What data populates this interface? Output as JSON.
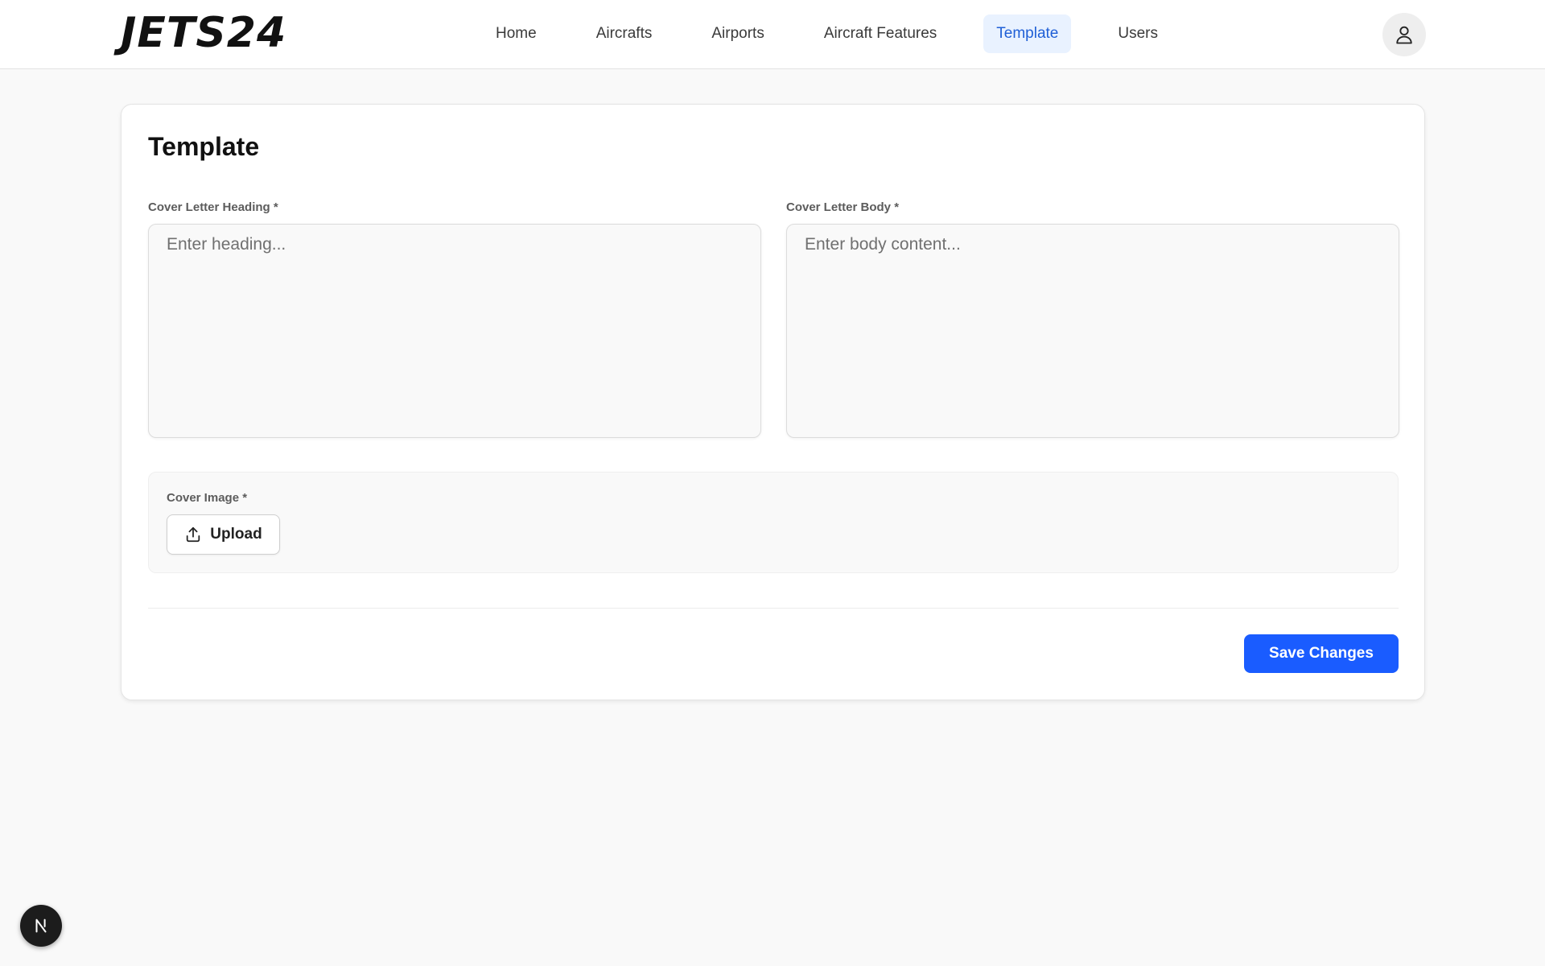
{
  "header": {
    "logo": "JETS24",
    "nav": [
      {
        "label": "Home"
      },
      {
        "label": "Aircrafts"
      },
      {
        "label": "Airports"
      },
      {
        "label": "Aircraft Features"
      },
      {
        "label": "Template",
        "active": true
      },
      {
        "label": "Users"
      }
    ],
    "avatar_icon": "user-icon"
  },
  "main": {
    "title": "Template",
    "heading_field": {
      "label": "Cover Letter Heading *",
      "value": "",
      "placeholder": "Enter heading..."
    },
    "body_field": {
      "label": "Cover Letter Body *",
      "value": "",
      "placeholder": "Enter body content..."
    },
    "cover_image": {
      "label": "Cover Image *",
      "upload_label": "Upload",
      "upload_icon": "upload-icon"
    },
    "save_label": "Save Changes"
  },
  "dev_badge": {
    "letter": "N",
    "icon": "nextjs-icon"
  },
  "colors": {
    "accent": "#1a5cff",
    "nav_active_bg": "#e9f2ff",
    "nav_active_text": "#1f5fd6",
    "page_bg": "#f9f9f9"
  }
}
